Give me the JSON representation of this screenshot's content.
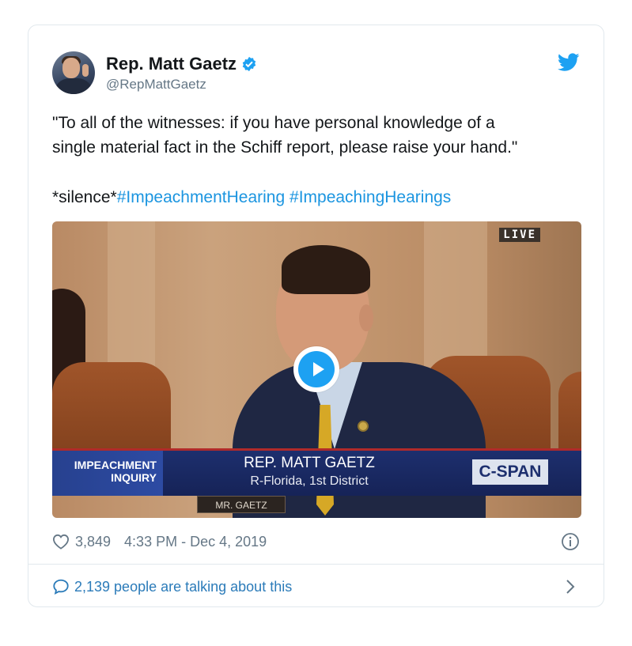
{
  "tweet": {
    "author_name": "Rep. Matt Gaetz",
    "handle": "@RepMattGaetz",
    "text_lines": [
      "\"To all of the witnesses: if you have personal knowledge of a",
      "single material fact in the Schiff report, please raise your hand.\""
    ],
    "text_prefix": "*silence*",
    "hashtags": [
      "#ImpeachmentHearing",
      "#ImpeachingHearings"
    ],
    "likes": "3,849",
    "timestamp": "4:33 PM - Dec 4, 2019",
    "talking": "2,139 people are talking about this"
  },
  "video": {
    "live_label": "LIVE",
    "chyron_tag_line1": "IMPEACHMENT",
    "chyron_tag_line2": "INQUIRY",
    "chyron_title": "REP. MATT GAETZ",
    "chyron_subtitle": "R-Florida, 1st District",
    "network_logo": "C-SPAN",
    "nameplate": "MR. GAETZ"
  },
  "colors": {
    "accent": "#1da1f2",
    "link": "#1b95e0",
    "muted": "#657786"
  },
  "icons": [
    "verified-badge-icon",
    "twitter-bird-icon",
    "play-icon",
    "heart-icon",
    "info-icon",
    "reply-bubble-icon",
    "chevron-right-icon"
  ]
}
